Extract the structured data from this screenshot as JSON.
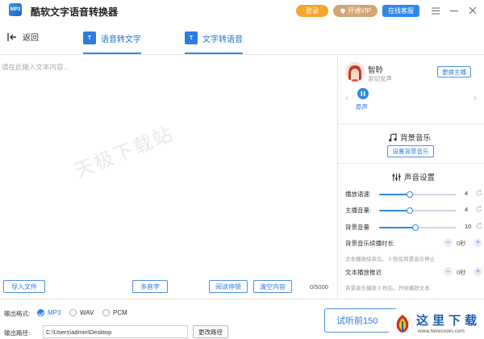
{
  "app": {
    "logo_text": "MP3",
    "title": "酷软文字语音转换器"
  },
  "header": {
    "login_label": "登录",
    "vip_label": "开通VIP",
    "service_label": "在线客服"
  },
  "nav": {
    "back_label": "返回",
    "tabs": [
      {
        "label": "语音转文字",
        "icon": "T",
        "active": false
      },
      {
        "label": "文字转语音",
        "icon": "T",
        "active": true
      }
    ]
  },
  "editor": {
    "placeholder": "请在此输入文本内容...",
    "watermark": "天极下载站",
    "import_label": "导入文件",
    "polyphone_label": "多音字",
    "pause_label": "阅读停顿",
    "clear_label": "清空内容",
    "char_count": "0/5000"
  },
  "anchor": {
    "name": "智聆",
    "description": "亲切女声",
    "change_label": "更换主播",
    "voice_label": "原声",
    "prev_icon": "chevron-left-icon",
    "next_icon": "chevron-right-icon"
  },
  "bgm": {
    "title": "背景音乐",
    "set_label": "设置背景音乐"
  },
  "settings": {
    "title": "声音设置",
    "sliders": [
      {
        "label": "播放语速:",
        "value": "4",
        "level": 0.4
      },
      {
        "label": "主播音量:",
        "value": "4",
        "level": 0.4
      },
      {
        "label": "背景音量",
        "value": "10",
        "level": 0.47
      }
    ],
    "bgm_duration": {
      "label": "背景音乐续播时长",
      "value": "0秒",
      "hint": "文本播放结束后，  0 秒后背景音乐停止"
    },
    "text_delay": {
      "label": "文本播放推迟",
      "value": "0秒",
      "hint": "背景音乐播放  0 秒后，开始播放文本"
    }
  },
  "output": {
    "format_label": "输出格式:",
    "formats": [
      {
        "label": "MP3",
        "selected": true
      },
      {
        "label": "WAV",
        "selected": false
      },
      {
        "label": "PCM",
        "selected": false
      }
    ],
    "path_label": "输出路径:",
    "path_value": "C:\\Users\\admin\\Desktop",
    "change_path_label": "更改路径",
    "preview_label": "试听前150"
  },
  "site": {
    "name": "这里下载",
    "url": "www.herecown.com"
  },
  "colors": {
    "accent": "#2f88e8",
    "login": "#f6a62f",
    "vip": "#d4a574"
  }
}
